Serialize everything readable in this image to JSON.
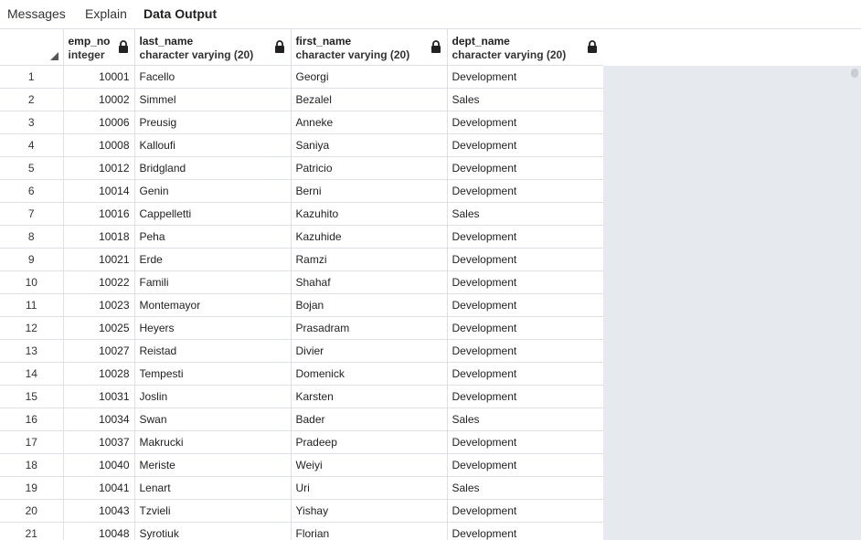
{
  "tabs": [
    {
      "label": "Messages"
    },
    {
      "label": "Explain"
    },
    {
      "label": "Data Output"
    }
  ],
  "columns": [
    {
      "name": "emp_no",
      "type": "integer"
    },
    {
      "name": "last_name",
      "type": "character varying (20)"
    },
    {
      "name": "first_name",
      "type": "character varying (20)"
    },
    {
      "name": "dept_name",
      "type": "character varying (20)"
    }
  ],
  "rows": [
    {
      "n": "1",
      "emp_no": "10001",
      "last_name": "Facello",
      "first_name": "Georgi",
      "dept_name": "Development"
    },
    {
      "n": "2",
      "emp_no": "10002",
      "last_name": "Simmel",
      "first_name": "Bezalel",
      "dept_name": "Sales"
    },
    {
      "n": "3",
      "emp_no": "10006",
      "last_name": "Preusig",
      "first_name": "Anneke",
      "dept_name": "Development"
    },
    {
      "n": "4",
      "emp_no": "10008",
      "last_name": "Kalloufi",
      "first_name": "Saniya",
      "dept_name": "Development"
    },
    {
      "n": "5",
      "emp_no": "10012",
      "last_name": "Bridgland",
      "first_name": "Patricio",
      "dept_name": "Development"
    },
    {
      "n": "6",
      "emp_no": "10014",
      "last_name": "Genin",
      "first_name": "Berni",
      "dept_name": "Development"
    },
    {
      "n": "7",
      "emp_no": "10016",
      "last_name": "Cappelletti",
      "first_name": "Kazuhito",
      "dept_name": "Sales"
    },
    {
      "n": "8",
      "emp_no": "10018",
      "last_name": "Peha",
      "first_name": "Kazuhide",
      "dept_name": "Development"
    },
    {
      "n": "9",
      "emp_no": "10021",
      "last_name": "Erde",
      "first_name": "Ramzi",
      "dept_name": "Development"
    },
    {
      "n": "10",
      "emp_no": "10022",
      "last_name": "Famili",
      "first_name": "Shahaf",
      "dept_name": "Development"
    },
    {
      "n": "11",
      "emp_no": "10023",
      "last_name": "Montemayor",
      "first_name": "Bojan",
      "dept_name": "Development"
    },
    {
      "n": "12",
      "emp_no": "10025",
      "last_name": "Heyers",
      "first_name": "Prasadram",
      "dept_name": "Development"
    },
    {
      "n": "13",
      "emp_no": "10027",
      "last_name": "Reistad",
      "first_name": "Divier",
      "dept_name": "Development"
    },
    {
      "n": "14",
      "emp_no": "10028",
      "last_name": "Tempesti",
      "first_name": "Domenick",
      "dept_name": "Development"
    },
    {
      "n": "15",
      "emp_no": "10031",
      "last_name": "Joslin",
      "first_name": "Karsten",
      "dept_name": "Development"
    },
    {
      "n": "16",
      "emp_no": "10034",
      "last_name": "Swan",
      "first_name": "Bader",
      "dept_name": "Sales"
    },
    {
      "n": "17",
      "emp_no": "10037",
      "last_name": "Makrucki",
      "first_name": "Pradeep",
      "dept_name": "Development"
    },
    {
      "n": "18",
      "emp_no": "10040",
      "last_name": "Meriste",
      "first_name": "Weiyi",
      "dept_name": "Development"
    },
    {
      "n": "19",
      "emp_no": "10041",
      "last_name": "Lenart",
      "first_name": "Uri",
      "dept_name": "Sales"
    },
    {
      "n": "20",
      "emp_no": "10043",
      "last_name": "Tzvieli",
      "first_name": "Yishay",
      "dept_name": "Development"
    },
    {
      "n": "21",
      "emp_no": "10048",
      "last_name": "Syrotiuk",
      "first_name": "Florian",
      "dept_name": "Development"
    }
  ],
  "icons": {
    "lock": "lock-icon",
    "sort": "sort-corner-icon"
  },
  "colors": {
    "grid_line": "#dde0e6",
    "empty_area": "#e6e9ee",
    "text": "#222222"
  }
}
